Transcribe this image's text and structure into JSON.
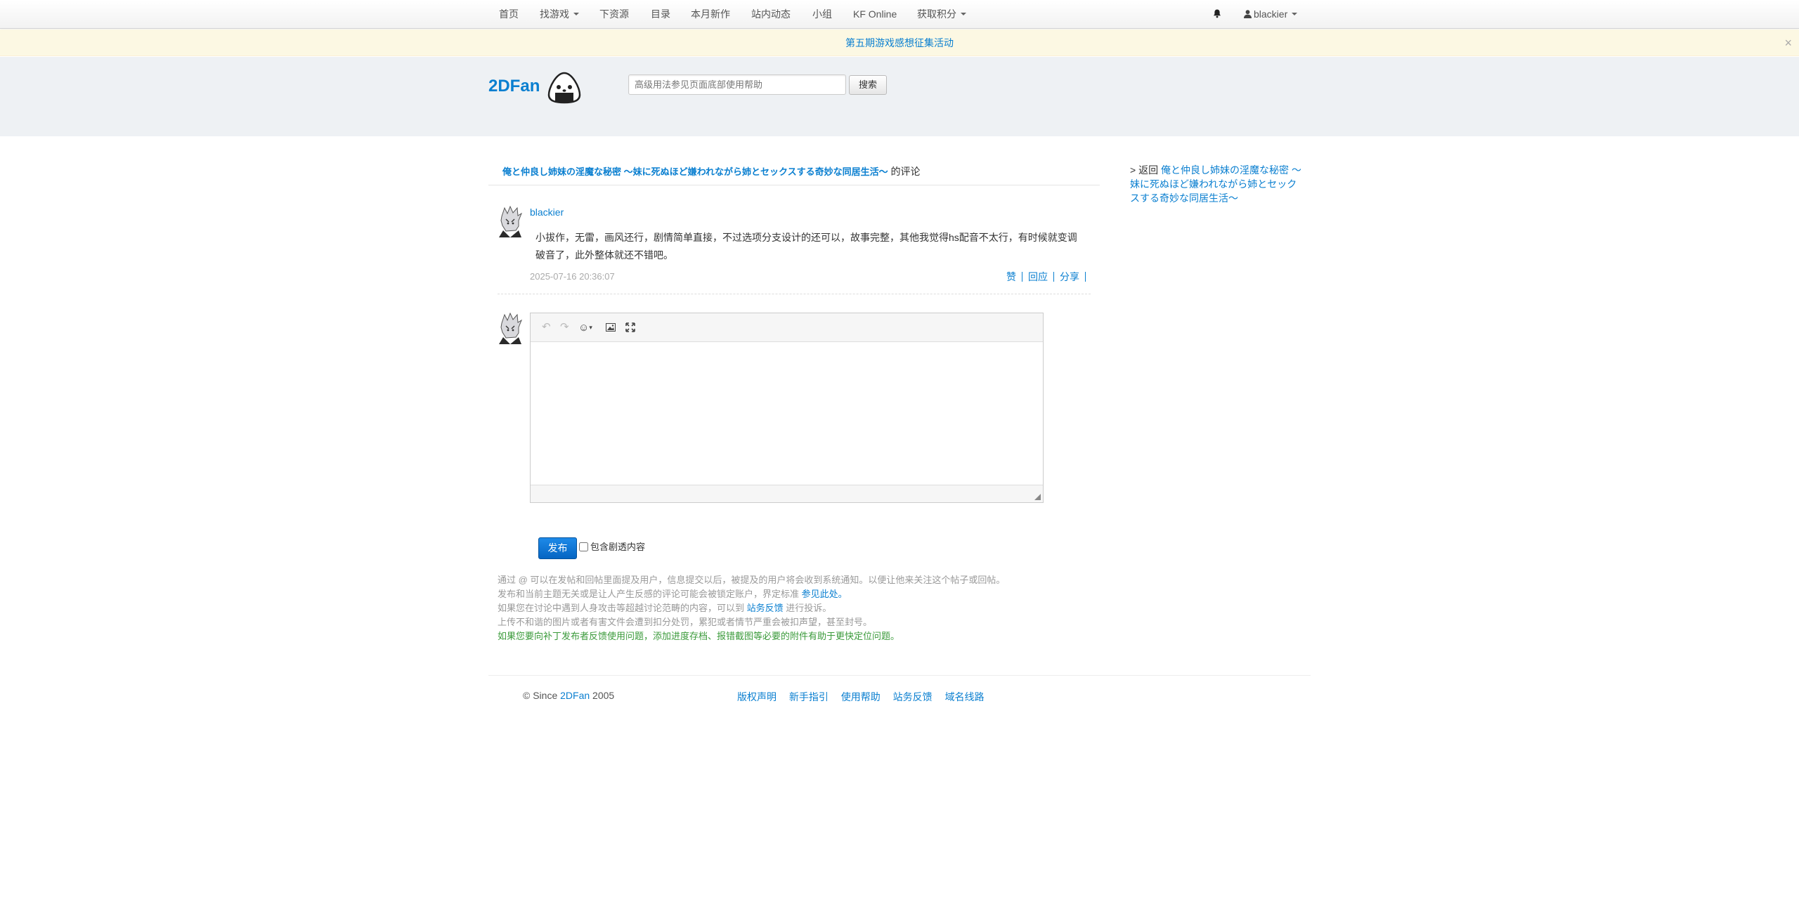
{
  "nav": {
    "home": "首页",
    "find_games": "找游戏",
    "downloads": "下资源",
    "catalog": "目录",
    "new_this_month": "本月新作",
    "site_activity": "站内动态",
    "groups": "小组",
    "kf_online": "KF Online",
    "earn_points": "获取积分",
    "bell_icon": "bell-icon",
    "username": "blackier"
  },
  "notice": {
    "text": "第五期游戏感想征集活动",
    "close": "×"
  },
  "header": {
    "logo_text": "2DFan",
    "search_placeholder": "高级用法参见页面底部使用帮助",
    "search_button": "搜索"
  },
  "page": {
    "game_title": "俺と仲良し姉妹の淫魔な秘密 ～妹に死ぬほど嫌われながら姉とセックスする奇妙な同居生活～",
    "title_suffix": "的评论",
    "back_prefix": "> 返回",
    "back_link": "俺と仲良し姉妹の淫魔な秘密 ～妹に死ぬほど嫌われながら姉とセックスする奇妙な同居生活～"
  },
  "comment": {
    "author": "blackier",
    "body": "小拔作，无雷，画风还行，剧情简单直接，不过选项分支设计的还可以，故事完整，其他我觉得hs配音不太行，有时候就变调破音了，此外整体就还不错吧。",
    "time": "2025-07-16 20:36:07",
    "like": "赞",
    "reply": "回应",
    "share": "分享"
  },
  "editor": {
    "undo_icon": "undo-icon",
    "redo_icon": "redo-icon",
    "emoji_icon": "emoji-icon",
    "image_icon": "image-icon",
    "fullscreen_icon": "fullscreen-icon",
    "submit": "发布",
    "spoiler_label": "包含剧透内容"
  },
  "help": {
    "line1": "通过 @ 可以在发帖和回帖里面提及用户，信息提交以后，被提及的用户将会收到系统通知。以便让他来关注这个帖子或回帖。",
    "line2_pre": "发布和当前主题无关或是让人产生反感的评论可能会被锁定账户，界定标准",
    "line2_link": "参见此处。",
    "line3_pre": "如果您在讨论中遇到人身攻击等超越讨论范畴的内容，可以到",
    "line3_link": "站务反馈",
    "line3_post": "进行投诉。",
    "line4": "上传不和谐的图片或者有害文件会遭到扣分处罚，累犯或者情节严重会被扣声望，甚至封号。",
    "line5": "如果您要向补丁发布者反馈使用问题，添加进度存档、报错截图等必要的附件有助于更快定位问题。"
  },
  "footer": {
    "copyright_pre": "© Since",
    "copyright_brand": "2DFan",
    "copyright_year": "2005",
    "links": [
      "版权声明",
      "新手指引",
      "使用帮助",
      "站务反馈",
      "域名线路"
    ]
  }
}
